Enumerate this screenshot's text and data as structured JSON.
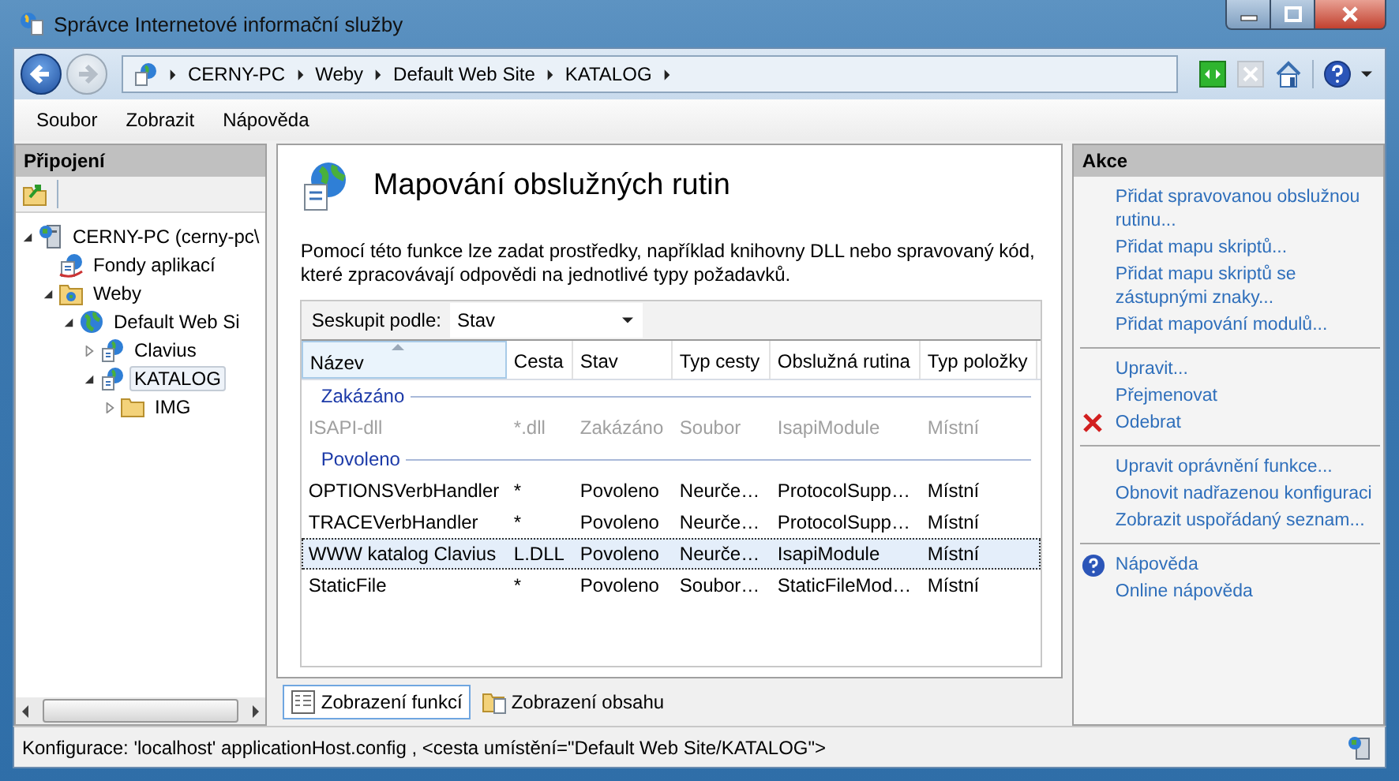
{
  "window": {
    "title": "Správce Internetové informační služby"
  },
  "address": {
    "crumbs": [
      "CERNY-PC",
      "Weby",
      "Default Web Site",
      "KATALOG"
    ]
  },
  "menu": [
    "Soubor",
    "Zobrazit",
    "Nápověda"
  ],
  "connections": {
    "title": "Připojení",
    "tree": [
      {
        "label": "CERNY-PC (cerny-pc\\",
        "kind": "server",
        "expanded": true,
        "selected": false,
        "children": [
          {
            "label": "Fondy aplikací",
            "kind": "pool",
            "selected": false
          },
          {
            "label": "Weby",
            "kind": "sites",
            "expanded": true,
            "selected": false,
            "children": [
              {
                "label": "Default Web Si",
                "kind": "site",
                "expanded": true,
                "selected": false,
                "children": [
                  {
                    "label": "Clavius",
                    "kind": "app",
                    "expanded": false,
                    "selected": false
                  },
                  {
                    "label": "KATALOG",
                    "kind": "app",
                    "expanded": true,
                    "selected": true,
                    "children": [
                      {
                        "label": "IMG",
                        "kind": "folder",
                        "expanded": false,
                        "selected": false
                      }
                    ]
                  }
                ]
              }
            ]
          }
        ]
      }
    ]
  },
  "feature": {
    "title": "Mapování obslužných rutin",
    "description": "Pomocí této funkce lze zadat prostředky, například knihovny DLL nebo spravovaný kód, které zpracovávají odpovědi na jednotlivé typy požadavků.",
    "group_by": {
      "label": "Seskupit podle:",
      "value": "Stav"
    },
    "columns": [
      {
        "label": "Název",
        "sorted": true
      },
      {
        "label": "Cesta",
        "sorted": false
      },
      {
        "label": "Stav",
        "sorted": false
      },
      {
        "label": "Typ cesty",
        "sorted": false
      },
      {
        "label": "Obslužná rutina",
        "sorted": false
      },
      {
        "label": "Typ položky",
        "sorted": false
      }
    ],
    "groups": [
      {
        "name": "Zakázáno",
        "disabled": true,
        "rows": [
          {
            "cells": [
              "ISAPI-dll",
              "*.dll",
              "Zakázáno",
              "Soubor",
              "IsapiModule",
              "Místní"
            ],
            "selected": false
          }
        ]
      },
      {
        "name": "Povoleno",
        "disabled": false,
        "rows": [
          {
            "cells": [
              "OPTIONSVerbHandler",
              "*",
              "Povoleno",
              "Neurče…",
              "ProtocolSupp…",
              "Místní"
            ],
            "selected": false
          },
          {
            "cells": [
              "TRACEVerbHandler",
              "*",
              "Povoleno",
              "Neurče…",
              "ProtocolSupp…",
              "Místní"
            ],
            "selected": false
          },
          {
            "cells": [
              "WWW katalog Clavius",
              "L.DLL",
              "Povoleno",
              "Neurče…",
              "IsapiModule",
              "Místní"
            ],
            "selected": true
          },
          {
            "cells": [
              "StaticFile",
              "*",
              "Povoleno",
              "Soubor…",
              "StaticFileMod…",
              "Místní"
            ],
            "selected": false
          }
        ]
      }
    ]
  },
  "view_tabs": [
    {
      "label": "Zobrazení funkcí",
      "kind": "features",
      "selected": true
    },
    {
      "label": "Zobrazení obsahu",
      "kind": "content",
      "selected": false
    }
  ],
  "actions": {
    "title": "Akce",
    "groups": [
      [
        {
          "label": "Přidat spravovanou obslužnou rutinu..."
        },
        {
          "label": "Přidat mapu skriptů..."
        },
        {
          "label": "Přidat mapu skriptů se zástupnými znaky..."
        },
        {
          "label": "Přidat mapování modulů..."
        }
      ],
      [
        {
          "label": "Upravit..."
        },
        {
          "label": "Přejmenovat"
        },
        {
          "label": "Odebrat",
          "kind": "remove"
        }
      ],
      [
        {
          "label": "Upravit oprávnění funkce..."
        },
        {
          "label": "Obnovit nadřazenou konfiguraci"
        },
        {
          "label": "Zobrazit uspořádaný seznam..."
        }
      ],
      [
        {
          "label": "Nápověda",
          "kind": "help"
        },
        {
          "label": "Online nápověda"
        }
      ]
    ]
  },
  "status_bar": "Konfigurace: 'localhost' applicationHost.config , <cesta umístění=\"Default Web Site/KATALOG\">"
}
